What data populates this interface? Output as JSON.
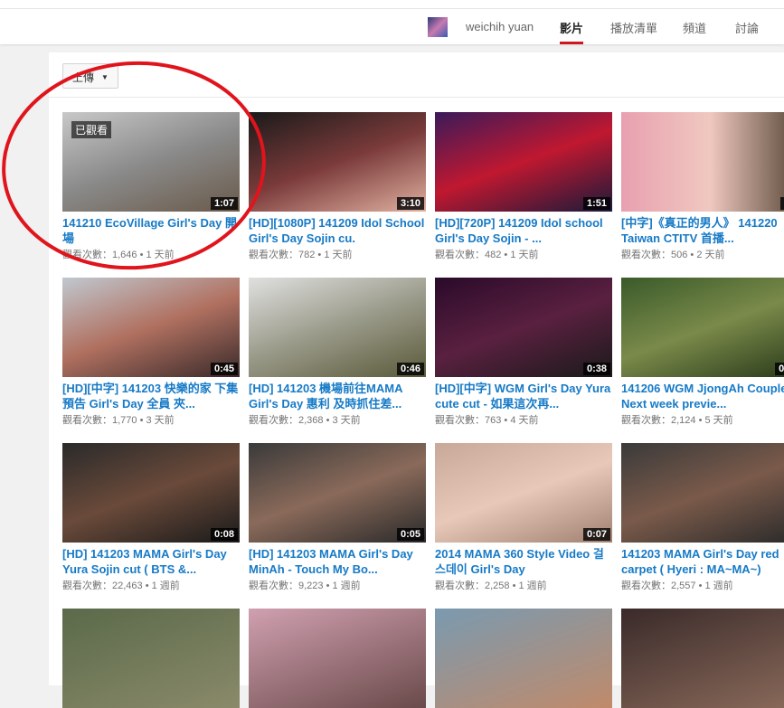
{
  "header": {
    "channel_name": "weichih yuan",
    "tabs": [
      {
        "label": "影片",
        "active": true
      },
      {
        "label": "播放清單"
      },
      {
        "label": "頻道"
      },
      {
        "label": "討論"
      }
    ]
  },
  "sort": {
    "label": "上傳"
  },
  "colors": {
    "accent": "#cc181e",
    "link": "#167ac6",
    "annotation": "#e0141c"
  },
  "videos": [
    {
      "title": "141210 EcoVillage Girl's Day 開場",
      "meta": "觀看次數：1,646 • 1 天前",
      "duration": "1:07",
      "watched": "已觀看",
      "bg": "linear-gradient(160deg,#c8c8c8,#8a8a8a 50%,#6a5a4a)"
    },
    {
      "title": "[HD][1080P] 141209 Idol School Girl's Day Sojin cu.",
      "meta": "觀看次數：782 • 1 天前",
      "duration": "3:10",
      "bg": "linear-gradient(160deg,#1a1a1a,#7a3a3a 50%,#e0b0a0)"
    },
    {
      "title": "[HD][720P] 141209 Idol school Girl's Day Sojin -   ...",
      "meta": "觀看次數：482 • 1 天前",
      "duration": "1:51",
      "bg": "linear-gradient(160deg,#3a1a5a,#c01830 50%,#1a1a3a)"
    },
    {
      "title": "[中字]《真正的男人》 141220 Taiwan CTITV 首播...",
      "meta": "觀看次數：506 • 2 天前",
      "duration": "0:",
      "bg": "linear-gradient(90deg,#e8a0b0,#f0c8c0 50%,#5a4a3a)"
    },
    {
      "title": "[HD][中字] 141203 快樂的家 下集預告 Girl's Day 全員 夾...",
      "meta": "觀看次數：1,770 • 3 天前",
      "duration": "0:45",
      "bg": "linear-gradient(160deg,#c0c8d0,#b07060 50%,#3a2a2a)"
    },
    {
      "title": "[HD] 141203 機場前往MAMA Girl's Day 惠利 及時抓住差...",
      "meta": "觀看次數：2,368 • 3 天前",
      "duration": "0:46",
      "bg": "linear-gradient(160deg,#e0e0e0,#9a9a8a 50%,#5a5a3a)"
    },
    {
      "title": "[HD][中字] WGM Girl's Day Yura cute cut - 如果這次再...",
      "meta": "觀看次數：763 • 4 天前",
      "duration": "0:38",
      "bg": "linear-gradient(160deg,#2a0a2a,#5a2040 50%,#1a1a1a)"
    },
    {
      "title": "141206 WGM JjongAh Couple Next week previe...",
      "meta": "觀看次數：2,124 • 5 天前",
      "duration": "0:2",
      "bg": "linear-gradient(160deg,#3a5a2a,#7a8a4a 50%,#2a3a1a)"
    },
    {
      "title": "[HD] 141203 MAMA Girl's Day Yura Sojin cut ( BTS &...",
      "meta": "觀看次數：22,463 • 1 週前",
      "duration": "0:08",
      "bg": "linear-gradient(160deg,#2a2a2a,#6a4a3a 50%,#1a1a1a)"
    },
    {
      "title": "[HD] 141203 MAMA Girl's Day MinAh - Touch My Bo...",
      "meta": "觀看次數：9,223 • 1 週前",
      "duration": "0:05",
      "bg": "linear-gradient(160deg,#3a3a3a,#8a6a5a 50%,#2a2a2a)"
    },
    {
      "title": "2014 MAMA 360 Style Video 걸스데이 Girl's Day",
      "meta": "觀看次數：2,258 • 1 週前",
      "duration": "0:07",
      "bg": "linear-gradient(160deg,#c8a898,#e8c8b8 50%,#a08070)"
    },
    {
      "title": "141203 MAMA Girl's Day red carpet ( Hyeri : MA~MA~)",
      "meta": "觀看次數：2,557 • 1 週前",
      "duration": "",
      "bg": "linear-gradient(160deg,#3a3a3a,#7a5a4a 50%,#2a2a2a)"
    },
    {
      "title": "",
      "meta": "",
      "duration": "",
      "bg": "linear-gradient(160deg,#5a6a4a,#8a8a6a)"
    },
    {
      "title": "",
      "meta": "",
      "duration": "",
      "bg": "linear-gradient(160deg,#d0a0b0,#6a4a4a)"
    },
    {
      "title": "",
      "meta": "",
      "duration": "",
      "bg": "linear-gradient(160deg,#7a9ab0,#c08a6a)"
    },
    {
      "title": "",
      "meta": "",
      "duration": "",
      "bg": "linear-gradient(160deg,#3a2a2a,#8a6a5a)"
    }
  ]
}
